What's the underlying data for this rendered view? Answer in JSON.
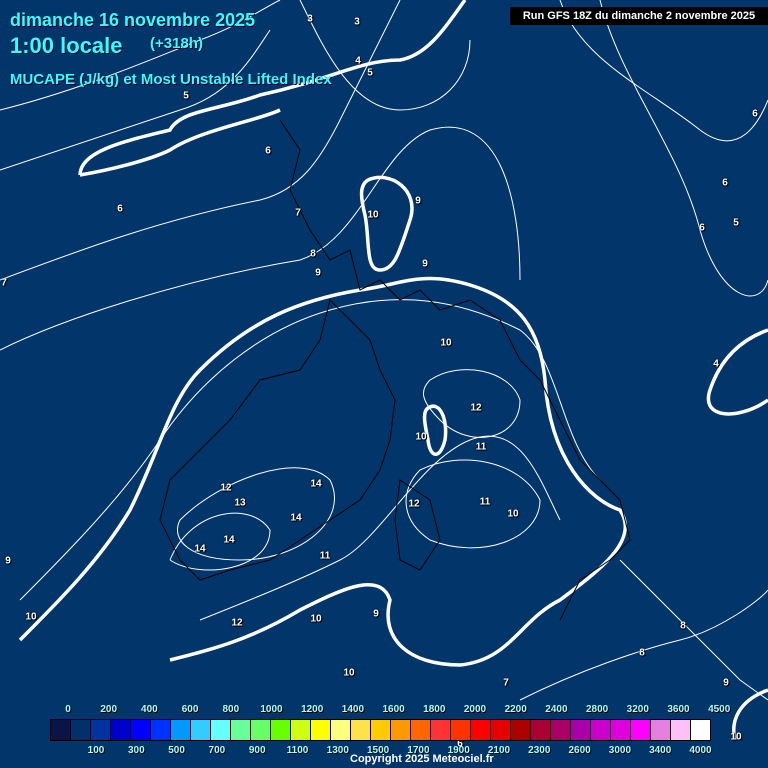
{
  "header": {
    "date": "dimanche 16 novembre 2025",
    "time": "1:00 locale",
    "lead": "(+318h)",
    "title": "MUCAPE (J/kg) et Most Unstable Lifted Index",
    "run": "Run GFS 18Z du dimanche 2 novembre 2025"
  },
  "contour_labels": [
    "3",
    "3",
    "4",
    "5",
    "5",
    "6",
    "6",
    "7",
    "8",
    "9",
    "9",
    "10",
    "9",
    "10",
    "12",
    "10",
    "11",
    "11",
    "12",
    "10",
    "12",
    "13",
    "14",
    "14",
    "14",
    "14",
    "11",
    "12",
    "10",
    "9",
    "10",
    "9",
    "6",
    "6",
    "6",
    "5",
    "4",
    "8",
    "8",
    "9",
    "7",
    "10",
    "6",
    "10",
    "7"
  ],
  "legend": {
    "top_labels": [
      "0",
      "200",
      "400",
      "600",
      "800",
      "1000",
      "1200",
      "1400",
      "1600",
      "1800",
      "2000",
      "2200",
      "2400",
      "2800",
      "3200",
      "3600",
      "4500"
    ],
    "bottom_labels": [
      "100",
      "300",
      "500",
      "700",
      "900",
      "1100",
      "1300",
      "1500",
      "1700",
      "1900",
      "2100",
      "2300",
      "2600",
      "3000",
      "3400",
      "4000"
    ],
    "colors": [
      "#0a1446",
      "#02306a",
      "#0033a0",
      "#0000cc",
      "#0000ff",
      "#0033ff",
      "#0099ff",
      "#33ccff",
      "#66ffff",
      "#66ff99",
      "#66ff66",
      "#66ff00",
      "#ccff11",
      "#ffff00",
      "#ffff80",
      "#ffe24a",
      "#ffcc00",
      "#ff9900",
      "#ff6600",
      "#ff3333",
      "#ff3300",
      "#ff0000",
      "#e60000",
      "#aa0000",
      "#aa0033",
      "#aa0066",
      "#aa00aa",
      "#cc00cc",
      "#dd00dd",
      "#ff00ff",
      "#e680e0",
      "#ffc0f8",
      "#ffffff"
    ]
  },
  "copyright": "Copyright 2025 Meteociel.fr"
}
